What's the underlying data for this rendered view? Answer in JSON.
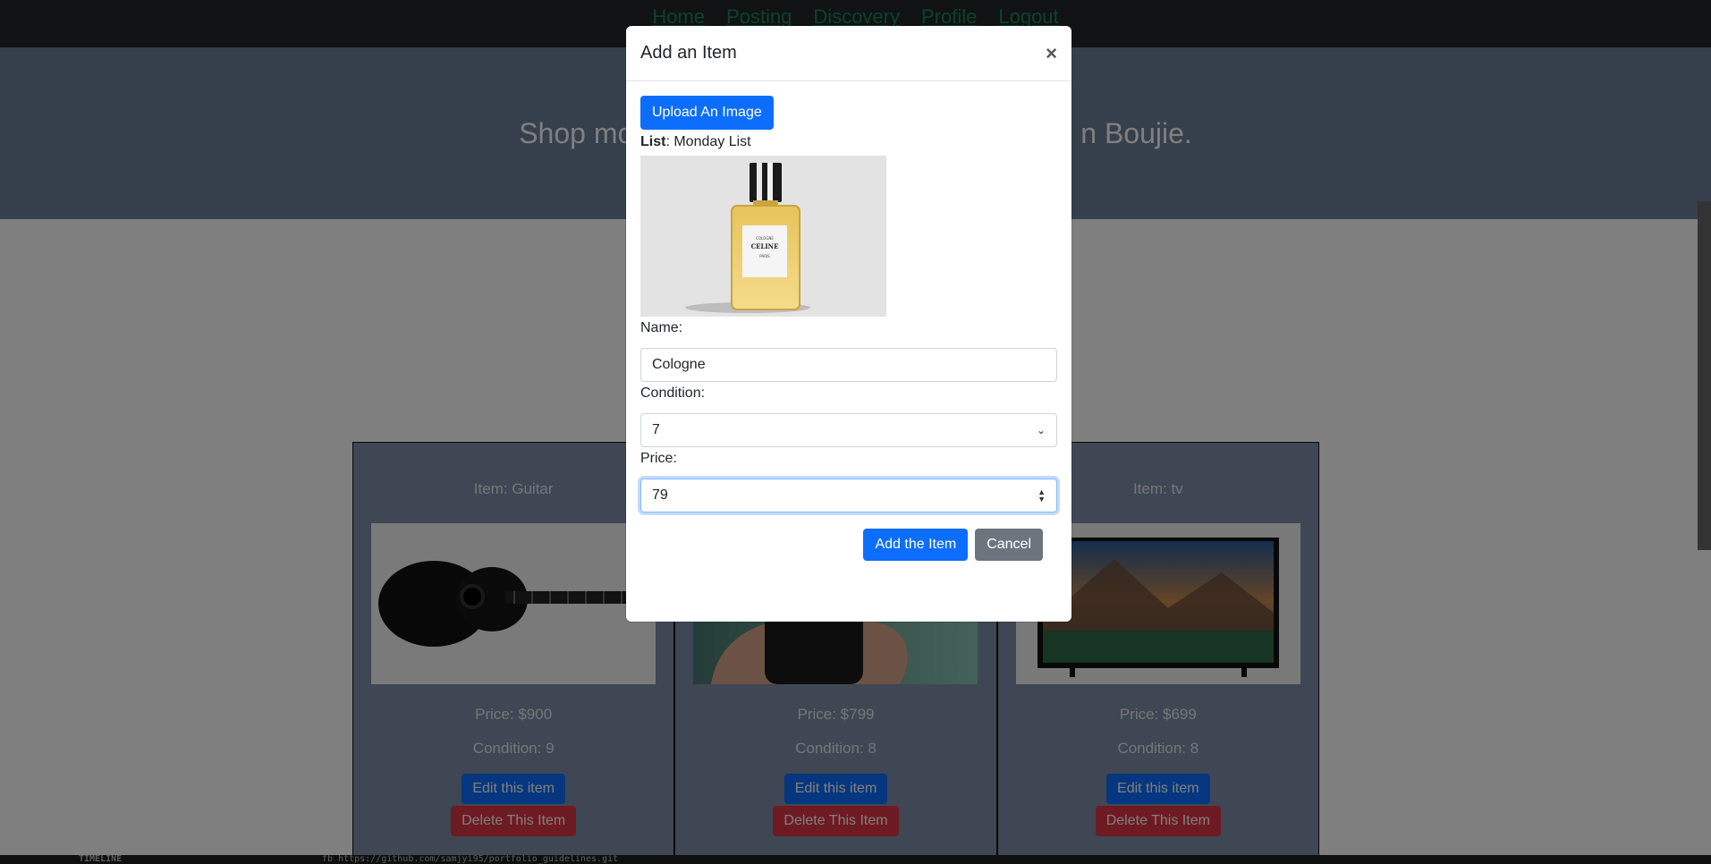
{
  "nav": {
    "links": [
      "Home",
      "Posting",
      "Discovery",
      "Profile",
      "Logout"
    ]
  },
  "hero": {
    "tagline_left": "Shop mo",
    "tagline_right": "n Boujie."
  },
  "cards": [
    {
      "name": "Item: Guitar",
      "price": "Price: $900",
      "condition": "Condition: 9",
      "edit_label": "Edit this item",
      "delete_label": "Delete This Item",
      "image": "acoustic-guitar"
    },
    {
      "name": "",
      "price": "Price: $799",
      "condition": "Condition: 8",
      "edit_label": "Edit this item",
      "delete_label": "Delete This Item",
      "image": "smartphone-in-hand"
    },
    {
      "name": "Item: tv",
      "price": "Price: $699",
      "condition": "Condition: 8",
      "edit_label": "Edit this item",
      "delete_label": "Delete This Item",
      "image": "television"
    }
  ],
  "terminal": {
    "label": "TIMELINE",
    "url": "fb https://github.com/samjyi95/portfolio_guidelines.git"
  },
  "modal": {
    "title": "Add an Item",
    "close": "×",
    "upload_label": "Upload An Image",
    "list_key": "List",
    "list_value": ": Monday List",
    "preview_image": "celine-cologne-bottle",
    "name_label": "Name:",
    "name_value": "Cologne",
    "condition_label": "Condition:",
    "condition_value": "7",
    "price_label": "Price:",
    "price_value": "79",
    "add_label": "Add the Item",
    "cancel_label": "Cancel"
  },
  "colors": {
    "primary": "#0d6efd",
    "danger": "#dc3545",
    "secondary": "#6c757d",
    "nav_link": "#198754",
    "navbar_bg": "#212529"
  }
}
